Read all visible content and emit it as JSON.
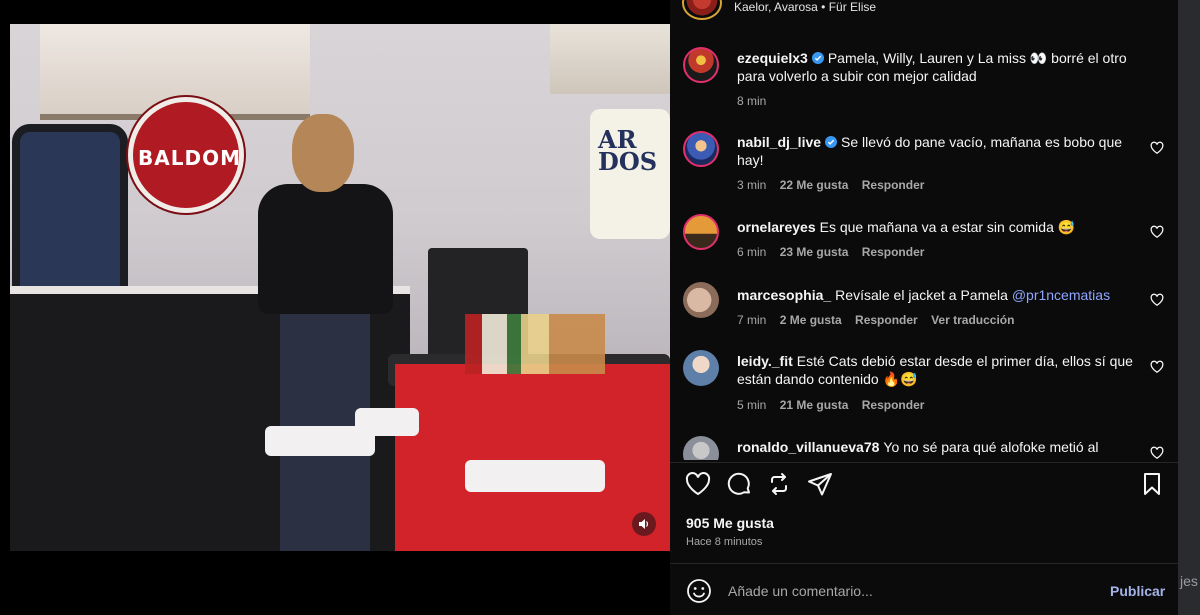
{
  "background_text": "jes",
  "header": {
    "song": "Kaelor, Avarosa • Für Elise"
  },
  "video": {
    "logo_text": "BALDOM",
    "sign_text": "AR DOS"
  },
  "comments": [
    {
      "user": "ezequielx3",
      "verified": true,
      "text": "Pamela, Willy, Lauren y La miss 👀  borré el otro para volverlo a subir con mejor calidad",
      "time": "8 min",
      "likes": "",
      "reply": "",
      "translate": "",
      "avatar_color": "#c0392b"
    },
    {
      "user": "nabil_dj_live",
      "verified": true,
      "text": "Se llevó do pane vacío, mañana es bobo que hay!",
      "time": "3 min",
      "likes": "22 Me gusta",
      "reply": "Responder",
      "translate": "",
      "avatar_color": "#3b5bb5"
    },
    {
      "user": "ornelareyes",
      "verified": false,
      "text": "Es que mañana va a estar sin comida 😅",
      "time": "6 min",
      "likes": "23 Me gusta",
      "reply": "Responder",
      "translate": "",
      "avatar_color": "#c7792b"
    },
    {
      "user": "marcesophia_",
      "verified": false,
      "text": "Revísale el jacket a Pamela",
      "mention": "@pr1ncematias",
      "time": "7 min",
      "likes": "2 Me gusta",
      "reply": "Responder",
      "translate": "Ver traducción",
      "avatar_color": "#b9a08c"
    },
    {
      "user": "leidy._fit",
      "verified": false,
      "text": "Esté Cats debió estar desde el primer día, ellos sí que están dando contenido 🔥😅",
      "time": "5 min",
      "likes": "21 Me gusta",
      "reply": "Responder",
      "translate": "",
      "avatar_color": "#5e7fa8"
    },
    {
      "user": "ronaldo_villanueva78",
      "verified": false,
      "text": "Yo no sé para qué alofoke metió al",
      "time": "",
      "likes": "",
      "reply": "",
      "translate": "",
      "avatar_color": "#8a8f9a"
    }
  ],
  "post": {
    "likes": "905 Me gusta",
    "time": "Hace 8 minutos"
  },
  "compose": {
    "placeholder": "Añade un comentario...",
    "publish_label": "Publicar"
  },
  "colors": {
    "accent_link": "#8fa6ff",
    "publish": "#a5b4e8",
    "verified": "#3897f0"
  }
}
